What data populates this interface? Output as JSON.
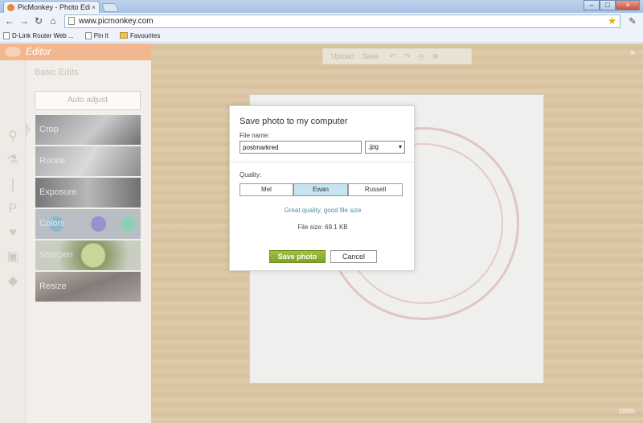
{
  "browser": {
    "tab_title": "PicMonkey - Photo Editing",
    "tab_close": "×",
    "url": "www.picmonkey.com",
    "bookmarks": [
      "D-Link Router Web ...",
      "Pin It",
      "Favourites"
    ]
  },
  "app": {
    "brand": "Editor",
    "section_title": "Basic Edits",
    "auto_adjust": "Auto adjust",
    "tools": [
      "Crop",
      "Rotate",
      "Exposure",
      "Colors",
      "Sharpen",
      "Resize"
    ],
    "top_toolbar": {
      "upload": "Upload",
      "save": "Save"
    },
    "close": "×",
    "zoom": "100%"
  },
  "dialog": {
    "title": "Save photo to my computer",
    "file_name_label": "File name:",
    "file_name_value": "postmarkred",
    "extension": ".jpg",
    "quality_label": "Quality:",
    "quality_options": [
      "Mel",
      "Ewan",
      "Russell"
    ],
    "quality_selected": "Ewan",
    "quality_description": "Great quality, good file size",
    "file_size": "File size: 69.1 KB",
    "save_button": "Save photo",
    "cancel_button": "Cancel"
  }
}
